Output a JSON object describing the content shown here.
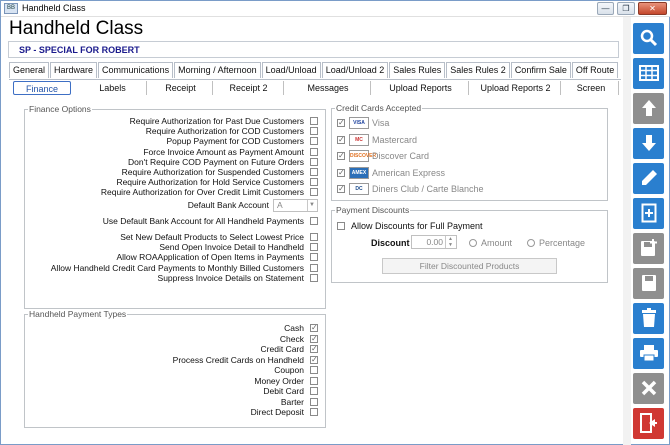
{
  "window": {
    "title": "Handheld Class",
    "app_icon": "app-icon",
    "controls": [
      "—",
      "❐",
      "✕"
    ]
  },
  "page": {
    "title": "Handheld Class",
    "subtitle": "SP - SPECIAL FOR ROBERT"
  },
  "tabs_row1": [
    "General",
    "Hardware",
    "Communications",
    "Morning / Afternoon",
    "Load/Unload",
    "Load/Unload 2",
    "Sales Rules",
    "Sales Rules 2",
    "Confirm Sale",
    "Off Route"
  ],
  "tabs_row2": [
    "Finance",
    "Labels",
    "Receipt",
    "Receipt 2",
    "Messages",
    "Upload Reports",
    "Upload Reports 2",
    "Screen"
  ],
  "active_tab": "Finance",
  "finance_options": {
    "title": "Finance Options",
    "items1": [
      {
        "label": "Require Authorization for Past Due Customers",
        "checked": false
      },
      {
        "label": "Require Authorization for COD Customers",
        "checked": false
      },
      {
        "label": "Popup Payment for COD Customers",
        "checked": false
      },
      {
        "label": "Force Invoice Amount as Payment Amount",
        "checked": false
      },
      {
        "label": "Don't Require COD Payment on Future Orders",
        "checked": false
      },
      {
        "label": "Require Authorization for Suspended Customers",
        "checked": false
      },
      {
        "label": "Require Authorization for Hold Service Customers",
        "checked": false
      },
      {
        "label": "Require Authorization for Over Credit Limit Customers",
        "checked": false
      }
    ],
    "default_bank_label": "Default Bank Account",
    "default_bank_value": "A",
    "use_default_bank": {
      "label": "Use Default Bank Account for All Handheld Payments",
      "checked": false
    },
    "items2": [
      {
        "label": "Set New Default Products to Select Lowest Price",
        "checked": false
      },
      {
        "label": "Send Open Invoice Detail to Handheld",
        "checked": false
      },
      {
        "label": "Allow ROAApplication of Open Items in Payments",
        "checked": false
      },
      {
        "label": "Allow Handheld Credit Card Payments to Monthly Billed Customers",
        "checked": false
      },
      {
        "label": "Suppress Invoice Details on Statement",
        "checked": false
      }
    ]
  },
  "payment_types": {
    "title": "Handheld Payment Types",
    "items": [
      {
        "label": "Cash",
        "checked": true
      },
      {
        "label": "Check",
        "checked": true
      },
      {
        "label": "Credit Card",
        "checked": true
      },
      {
        "label": "Process Credit Cards on Handheld",
        "checked": true
      },
      {
        "label": "Coupon",
        "checked": false
      },
      {
        "label": "Money Order",
        "checked": false
      },
      {
        "label": "Debit Card",
        "checked": false
      },
      {
        "label": "Barter",
        "checked": false
      },
      {
        "label": "Direct Deposit",
        "checked": false
      }
    ]
  },
  "credit_cards": {
    "title": "Credit Cards Accepted",
    "items": [
      {
        "name": "Visa",
        "logo": "VISA",
        "checked": true
      },
      {
        "name": "Mastercard",
        "logo": "MC",
        "checked": true
      },
      {
        "name": "Discover Card",
        "logo": "DISCOVER",
        "checked": true
      },
      {
        "name": "American Express",
        "logo": "AMEX",
        "checked": true
      },
      {
        "name": "Diners Club / Carte Blanche",
        "logo": "DC",
        "checked": true
      }
    ]
  },
  "payment_discounts": {
    "title": "Payment Discounts",
    "allow_label": "Allow Discounts for Full Payment",
    "allow_checked": false,
    "discount_label": "Discount",
    "discount_value": "0.00",
    "amount_label": "Amount",
    "percentage_label": "Percentage",
    "filter_button": "Filter Discounted Products"
  },
  "sidebar": [
    "search-icon",
    "grid-icon",
    "arrow-up-icon",
    "arrow-down-icon",
    "pencil-icon",
    "new-document-icon",
    "save-new-icon",
    "save-icon",
    "trash-icon",
    "print-icon",
    "close-icon",
    "exit-icon"
  ],
  "colors": {
    "accent": "#2a7fcf",
    "disabled": "#8f8f8f",
    "exit": "#d03833",
    "subtitle": "#1a1a8c"
  }
}
